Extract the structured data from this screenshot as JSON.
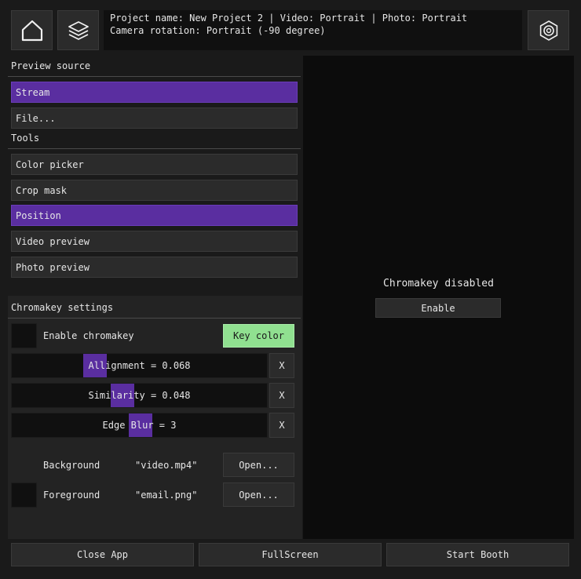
{
  "header": {
    "home_icon": "home-icon",
    "layers_icon": "layers-icon",
    "settings_icon": "settings-hexagon-icon",
    "info_line1": "Project name: New Project 2 | Video: Portrait | Photo: Portrait",
    "info_line2": "Camera rotation: Portrait (-90 degree)"
  },
  "preview_source": {
    "title": "Preview source",
    "items": [
      {
        "label": "Stream",
        "selected": true
      },
      {
        "label": "File...",
        "selected": false
      }
    ]
  },
  "tools": {
    "title": "Tools",
    "items": [
      {
        "label": "Color picker",
        "selected": false
      },
      {
        "label": "Crop mask",
        "selected": false
      },
      {
        "label": "Position",
        "selected": true
      },
      {
        "label": "Video preview",
        "selected": false
      },
      {
        "label": "Photo preview",
        "selected": false
      }
    ]
  },
  "chromakey": {
    "title": "Chromakey settings",
    "enable_label": "Enable chromakey",
    "key_color_label": "Key color",
    "key_color": "#90e090",
    "sliders": [
      {
        "label": "Allignment = 0.068",
        "value": 0.068,
        "reset": "X"
      },
      {
        "label": "Similarity = 0.048",
        "value": 0.048,
        "reset": "X"
      },
      {
        "label": "Edge Blur = 3",
        "value": 3,
        "reset": "X"
      }
    ],
    "background": {
      "label": "Background",
      "file": "\"video.mp4\"",
      "open": "Open..."
    },
    "foreground": {
      "label": "Foreground",
      "file": "\"email.png\"",
      "open": "Open..."
    }
  },
  "preview": {
    "status": "Chromakey disabled",
    "enable_button": "Enable"
  },
  "footer": {
    "close": "Close App",
    "fullscreen": "FullScreen",
    "start": "Start Booth"
  },
  "colors": {
    "accent": "#5a2ea0",
    "background": "#1a1a1a",
    "panel": "#2b2b2b",
    "key_color_button": "#90e090"
  }
}
